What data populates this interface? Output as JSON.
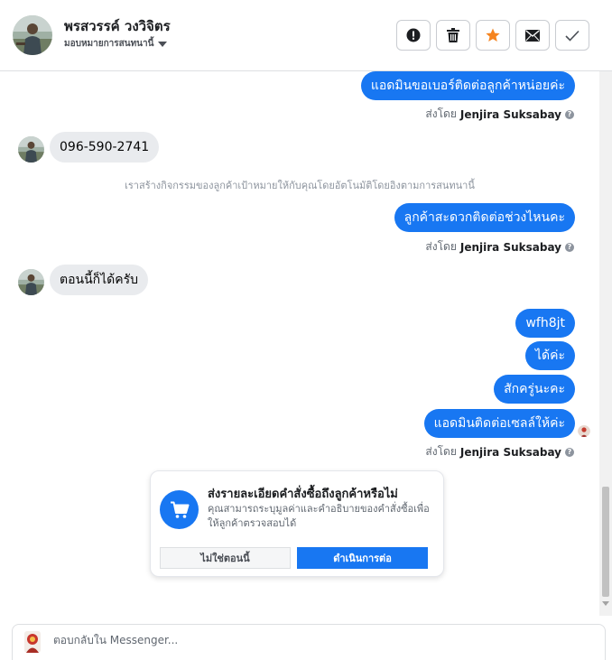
{
  "header": {
    "contact_name": "พรสวรรค์ วงวิจิตร",
    "assign_label": "มอบหมายการสนทนานี้",
    "actions": [
      {
        "name": "report-button",
        "icon": "exclamation-icon"
      },
      {
        "name": "delete-button",
        "icon": "trash-icon"
      },
      {
        "name": "star-button",
        "icon": "star-icon"
      },
      {
        "name": "mark-unread-button",
        "icon": "envelope-icon"
      },
      {
        "name": "mark-done-button",
        "icon": "checkmark-icon"
      }
    ]
  },
  "thread": {
    "sent_by_prefix": "ส่งโดย",
    "agent_name": "Jenjira Suksabay",
    "messages": [
      {
        "id": "m1",
        "direction": "out",
        "text": "แอดมินขอเบอร์ติดต่อลูกค้าหน่อยค่ะ"
      },
      {
        "id": "m2",
        "direction": "in",
        "text": "096-590-2741"
      },
      {
        "id": "m3",
        "direction": "out",
        "text": "ลูกค้าสะดวกติดต่อช่วงไหนคะ"
      },
      {
        "id": "m4",
        "direction": "in",
        "text": "ตอนนี้ก็ได้ครับ"
      },
      {
        "id": "m5",
        "direction": "out",
        "text": "wfh8jt"
      },
      {
        "id": "m6",
        "direction": "out",
        "text": "ได้ค่ะ"
      },
      {
        "id": "m7",
        "direction": "out",
        "text": "สักครู่นะคะ"
      },
      {
        "id": "m8",
        "direction": "out",
        "text": "แอดมินติดต่อเซลล์ให้ค่ะ"
      }
    ],
    "system_note": "เราสร้างกิจกรรมของลูกค้าเป้าหมายให้กับคุณโดยอัตโนมัติโดยอิงตามการสนทนานี้"
  },
  "order_card": {
    "title": "ส่งรายละเอียดคำสั่งซื้อถึงลูกค้าหรือไม่",
    "description": "คุณสามารถระบุมูลค่าและคำอธิบายของคำสั่งซื้อเพื่อให้ลูกค้าตรวจสอบได้",
    "secondary_button": "ไม่ใช่ตอนนี้",
    "primary_button": "ดำเนินการต่อ",
    "icon": "shopping-cart-icon"
  },
  "composer": {
    "placeholder": "ตอบกลับใน Messenger..."
  },
  "colors": {
    "accent": "#1877f2",
    "incoming_bubble": "#e9ebee",
    "star": "#f5841f"
  }
}
